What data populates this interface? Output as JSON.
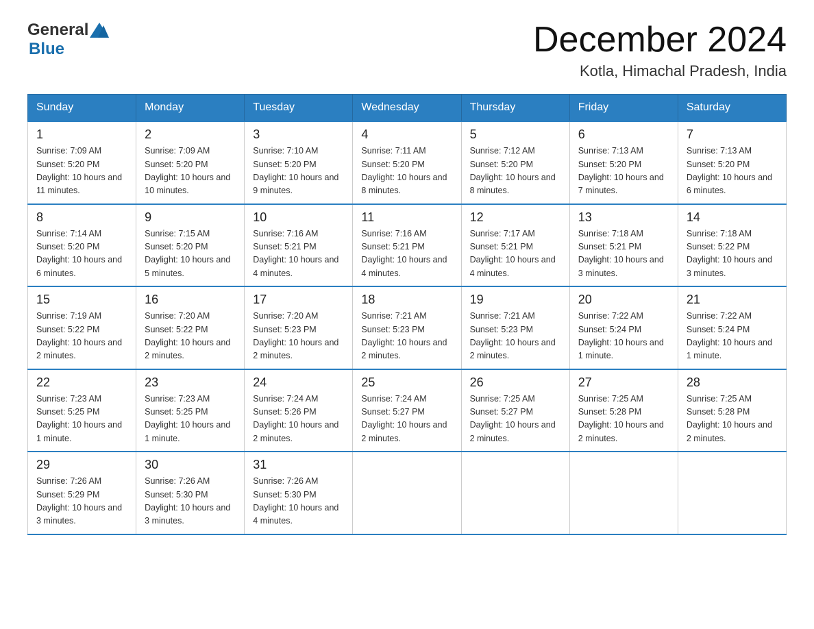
{
  "header": {
    "logo_text_general": "General",
    "logo_text_blue": "Blue",
    "month_year": "December 2024",
    "location": "Kotla, Himachal Pradesh, India"
  },
  "weekdays": [
    "Sunday",
    "Monday",
    "Tuesday",
    "Wednesday",
    "Thursday",
    "Friday",
    "Saturday"
  ],
  "weeks": [
    [
      {
        "day": "1",
        "sunrise": "7:09 AM",
        "sunset": "5:20 PM",
        "daylight": "10 hours and 11 minutes."
      },
      {
        "day": "2",
        "sunrise": "7:09 AM",
        "sunset": "5:20 PM",
        "daylight": "10 hours and 10 minutes."
      },
      {
        "day": "3",
        "sunrise": "7:10 AM",
        "sunset": "5:20 PM",
        "daylight": "10 hours and 9 minutes."
      },
      {
        "day": "4",
        "sunrise": "7:11 AM",
        "sunset": "5:20 PM",
        "daylight": "10 hours and 8 minutes."
      },
      {
        "day": "5",
        "sunrise": "7:12 AM",
        "sunset": "5:20 PM",
        "daylight": "10 hours and 8 minutes."
      },
      {
        "day": "6",
        "sunrise": "7:13 AM",
        "sunset": "5:20 PM",
        "daylight": "10 hours and 7 minutes."
      },
      {
        "day": "7",
        "sunrise": "7:13 AM",
        "sunset": "5:20 PM",
        "daylight": "10 hours and 6 minutes."
      }
    ],
    [
      {
        "day": "8",
        "sunrise": "7:14 AM",
        "sunset": "5:20 PM",
        "daylight": "10 hours and 6 minutes."
      },
      {
        "day": "9",
        "sunrise": "7:15 AM",
        "sunset": "5:20 PM",
        "daylight": "10 hours and 5 minutes."
      },
      {
        "day": "10",
        "sunrise": "7:16 AM",
        "sunset": "5:21 PM",
        "daylight": "10 hours and 4 minutes."
      },
      {
        "day": "11",
        "sunrise": "7:16 AM",
        "sunset": "5:21 PM",
        "daylight": "10 hours and 4 minutes."
      },
      {
        "day": "12",
        "sunrise": "7:17 AM",
        "sunset": "5:21 PM",
        "daylight": "10 hours and 4 minutes."
      },
      {
        "day": "13",
        "sunrise": "7:18 AM",
        "sunset": "5:21 PM",
        "daylight": "10 hours and 3 minutes."
      },
      {
        "day": "14",
        "sunrise": "7:18 AM",
        "sunset": "5:22 PM",
        "daylight": "10 hours and 3 minutes."
      }
    ],
    [
      {
        "day": "15",
        "sunrise": "7:19 AM",
        "sunset": "5:22 PM",
        "daylight": "10 hours and 2 minutes."
      },
      {
        "day": "16",
        "sunrise": "7:20 AM",
        "sunset": "5:22 PM",
        "daylight": "10 hours and 2 minutes."
      },
      {
        "day": "17",
        "sunrise": "7:20 AM",
        "sunset": "5:23 PM",
        "daylight": "10 hours and 2 minutes."
      },
      {
        "day": "18",
        "sunrise": "7:21 AM",
        "sunset": "5:23 PM",
        "daylight": "10 hours and 2 minutes."
      },
      {
        "day": "19",
        "sunrise": "7:21 AM",
        "sunset": "5:23 PM",
        "daylight": "10 hours and 2 minutes."
      },
      {
        "day": "20",
        "sunrise": "7:22 AM",
        "sunset": "5:24 PM",
        "daylight": "10 hours and 1 minute."
      },
      {
        "day": "21",
        "sunrise": "7:22 AM",
        "sunset": "5:24 PM",
        "daylight": "10 hours and 1 minute."
      }
    ],
    [
      {
        "day": "22",
        "sunrise": "7:23 AM",
        "sunset": "5:25 PM",
        "daylight": "10 hours and 1 minute."
      },
      {
        "day": "23",
        "sunrise": "7:23 AM",
        "sunset": "5:25 PM",
        "daylight": "10 hours and 1 minute."
      },
      {
        "day": "24",
        "sunrise": "7:24 AM",
        "sunset": "5:26 PM",
        "daylight": "10 hours and 2 minutes."
      },
      {
        "day": "25",
        "sunrise": "7:24 AM",
        "sunset": "5:27 PM",
        "daylight": "10 hours and 2 minutes."
      },
      {
        "day": "26",
        "sunrise": "7:25 AM",
        "sunset": "5:27 PM",
        "daylight": "10 hours and 2 minutes."
      },
      {
        "day": "27",
        "sunrise": "7:25 AM",
        "sunset": "5:28 PM",
        "daylight": "10 hours and 2 minutes."
      },
      {
        "day": "28",
        "sunrise": "7:25 AM",
        "sunset": "5:28 PM",
        "daylight": "10 hours and 2 minutes."
      }
    ],
    [
      {
        "day": "29",
        "sunrise": "7:26 AM",
        "sunset": "5:29 PM",
        "daylight": "10 hours and 3 minutes."
      },
      {
        "day": "30",
        "sunrise": "7:26 AM",
        "sunset": "5:30 PM",
        "daylight": "10 hours and 3 minutes."
      },
      {
        "day": "31",
        "sunrise": "7:26 AM",
        "sunset": "5:30 PM",
        "daylight": "10 hours and 4 minutes."
      },
      null,
      null,
      null,
      null
    ]
  ]
}
